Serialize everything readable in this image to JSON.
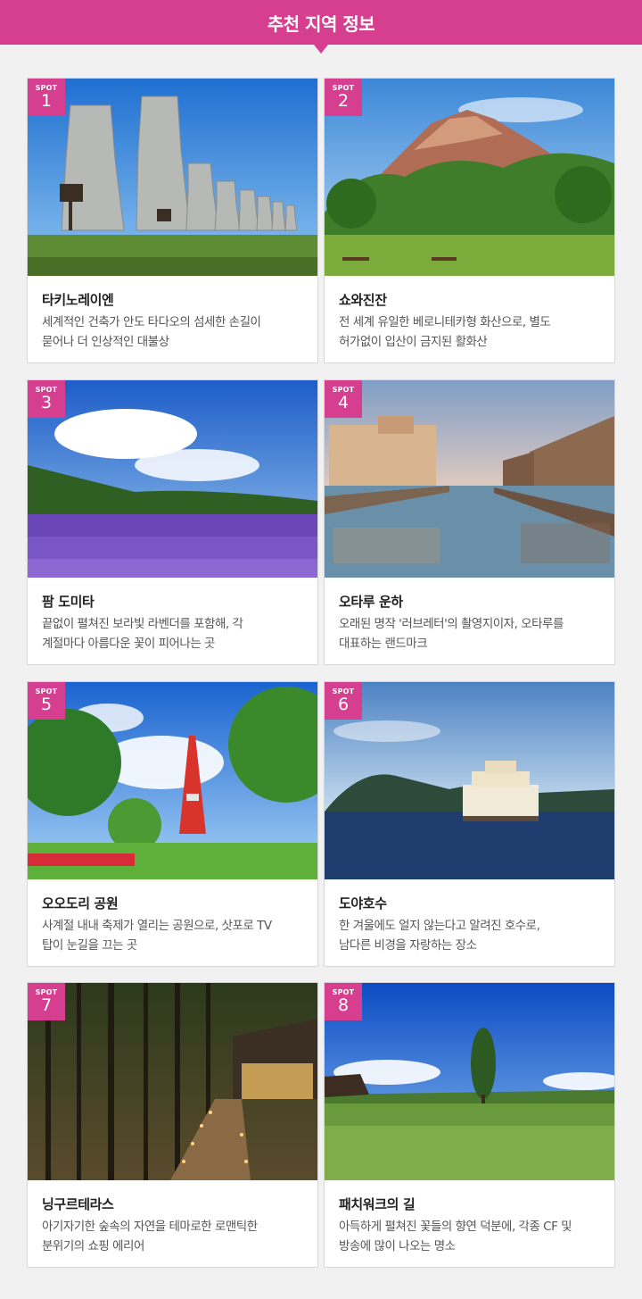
{
  "header": {
    "title": "추천 지역 정보"
  },
  "badge_label": "SPOT",
  "spots": [
    {
      "number": "1",
      "title": "타키노레이엔",
      "description": "세계적인 건축가 안도 타다오의 섬세한 손길이\n묻어나 더 인상적인 대불상"
    },
    {
      "number": "2",
      "title": "쇼와진잔",
      "description": "전 세계 유일한 베로니테카형 화산으로, 별도\n허가없이 입산이 금지된 활화산"
    },
    {
      "number": "3",
      "title": "팜 도미타",
      "description": "끝없이 펼쳐진 보라빛 라벤더를 포함해, 각\n계절마다 아름다운 꽃이 피어나는 곳"
    },
    {
      "number": "4",
      "title": "오타루 운하",
      "description": "오래된 명작 '러브레터'의 촬영지이자, 오타루를\n대표하는 랜드마크"
    },
    {
      "number": "5",
      "title": "오오도리 공원",
      "description": "사계절 내내 축제가 열리는 공원으로, 삿포로 TV\n탑이 눈길을 끄는 곳"
    },
    {
      "number": "6",
      "title": "도야호수",
      "description": "한 겨울에도 얼지 않는다고 알려진 호수로,\n남다른 비경을 자랑하는 장소"
    },
    {
      "number": "7",
      "title": "닝구르테라스",
      "description": "아기자기한 숲속의 자연을 테마로한 로맨틱한\n분위기의 쇼핑 에리어"
    },
    {
      "number": "8",
      "title": "패치워크의 길",
      "description": "아득하게 펼쳐진 꽃들의 향연 덕분에, 각종 CF 및\n방송에 많이 나오는 명소"
    }
  ],
  "colors": {
    "accent": "#d63f8f",
    "background": "#f1f1f1"
  }
}
